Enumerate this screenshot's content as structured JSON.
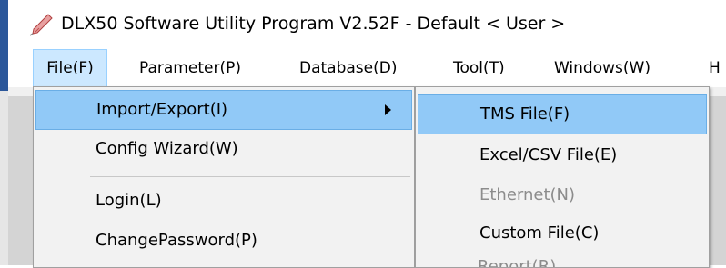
{
  "window": {
    "title": "DLX50 Software Utility Program V2.52F - Default < User >",
    "app_icon": "pen-icon",
    "accent_color": "#2b579a"
  },
  "menubar": {
    "items": [
      {
        "label": "File(F)",
        "active": true
      },
      {
        "label": "Parameter(P)"
      },
      {
        "label": "Database(D)"
      },
      {
        "label": "Tool(T)"
      },
      {
        "label": "Windows(W)"
      },
      {
        "label": "H"
      }
    ]
  },
  "file_menu": {
    "items": [
      {
        "label": "Import/Export(I)",
        "highlighted": true,
        "has_submenu": true,
        "submenu_arrow": "chevron-right-icon"
      },
      {
        "label": "Config Wizard(W)"
      },
      {
        "label": "Login(L)"
      },
      {
        "label": "ChangePassword(P)"
      }
    ]
  },
  "import_export_submenu": {
    "items": [
      {
        "label": "TMS File(F)",
        "highlighted": true
      },
      {
        "label": "Excel/CSV File(E)"
      },
      {
        "label": "Ethernet(N)",
        "disabled": true
      },
      {
        "label": "Custom File(C)"
      },
      {
        "label": "Report(R)",
        "disabled": true,
        "partially_visible": true
      }
    ]
  },
  "colors": {
    "menu_highlight": "#91c9f7",
    "menubar_active": "#cce8ff",
    "disabled_text": "#8c8c8c"
  }
}
